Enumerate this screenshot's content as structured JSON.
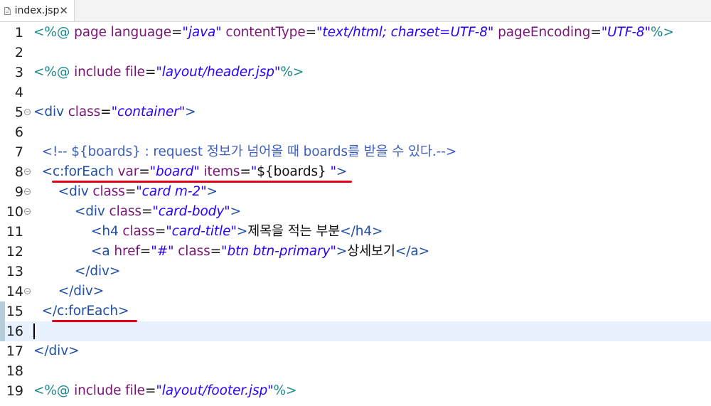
{
  "tab": {
    "title": "index.jsp",
    "icon": "jsp-file-icon",
    "close": "✕"
  },
  "colors": {
    "tag": "#1f4fa6",
    "attr": "#7a1578",
    "string": "#2a00ff",
    "comment": "#3f5fbf",
    "directive": "#1f8a8a",
    "highlight": "#e60012"
  },
  "lines": [
    {
      "num": "1",
      "segs": [
        [
          "tg",
          "<%@ "
        ],
        [
          "an",
          "page "
        ],
        [
          "an",
          "language"
        ],
        [
          "tx",
          "="
        ],
        [
          "sv",
          "\"java\""
        ],
        [
          "tx",
          " "
        ],
        [
          "an",
          "contentType"
        ],
        [
          "tx",
          "="
        ],
        [
          "sv",
          "\"text/html; charset=UTF-8\""
        ],
        [
          "tx",
          " "
        ],
        [
          "an",
          "pageEncoding"
        ],
        [
          "tx",
          "="
        ],
        [
          "sv",
          "\"UTF-8\""
        ],
        [
          "tg",
          "%>"
        ]
      ]
    },
    {
      "num": "2",
      "segs": []
    },
    {
      "num": "3",
      "segs": [
        [
          "tg",
          "<%@ "
        ],
        [
          "an",
          "include "
        ],
        [
          "an",
          "file"
        ],
        [
          "tx",
          "="
        ],
        [
          "sv",
          "\"layout/header.jsp\""
        ],
        [
          "tg",
          "%>"
        ]
      ]
    },
    {
      "num": "4",
      "segs": []
    },
    {
      "num": "5",
      "segs": [
        [
          "tb",
          "<div "
        ],
        [
          "an",
          "class"
        ],
        [
          "tx",
          "="
        ],
        [
          "sv",
          "\"container\""
        ],
        [
          "tb",
          ">"
        ]
      ],
      "fold": true
    },
    {
      "num": "6",
      "segs": []
    },
    {
      "num": "7",
      "segs": [
        [
          "tx",
          "  "
        ],
        [
          "cm",
          "<!-- ${boards} : request 정보가 넘어올 때 boards를 받을 수 있다.-->"
        ]
      ]
    },
    {
      "num": "8",
      "segs": [
        [
          "tx",
          "  "
        ],
        [
          "tb",
          "<c:forEach "
        ],
        [
          "an",
          "var"
        ],
        [
          "tx",
          "="
        ],
        [
          "sv",
          "\"board\""
        ],
        [
          "tx",
          " "
        ],
        [
          "an",
          "items"
        ],
        [
          "tx",
          "="
        ],
        [
          "sv",
          "\""
        ],
        [
          "tx",
          "${boards}"
        ],
        [
          "sv",
          " \""
        ],
        [
          "tb",
          ">"
        ]
      ],
      "fold": true
    },
    {
      "num": "9",
      "segs": [
        [
          "tx",
          "      "
        ],
        [
          "tb",
          "<div "
        ],
        [
          "an",
          "class"
        ],
        [
          "tx",
          "="
        ],
        [
          "sv",
          "\"card m-2\""
        ],
        [
          "tb",
          ">"
        ]
      ],
      "fold": true
    },
    {
      "num": "10",
      "segs": [
        [
          "tx",
          "          "
        ],
        [
          "tb",
          "<div "
        ],
        [
          "an",
          "class"
        ],
        [
          "tx",
          "="
        ],
        [
          "sv",
          "\"card-body\""
        ],
        [
          "tb",
          ">"
        ]
      ],
      "fold": true
    },
    {
      "num": "11",
      "segs": [
        [
          "tx",
          "              "
        ],
        [
          "tb",
          "<h4 "
        ],
        [
          "an",
          "class"
        ],
        [
          "tx",
          "="
        ],
        [
          "sv",
          "\"card-title\""
        ],
        [
          "tb",
          ">"
        ],
        [
          "tx",
          "제목을 적는 부분"
        ],
        [
          "tb",
          "</h4>"
        ]
      ]
    },
    {
      "num": "12",
      "segs": [
        [
          "tx",
          "              "
        ],
        [
          "tb",
          "<a "
        ],
        [
          "an",
          "href"
        ],
        [
          "tx",
          "="
        ],
        [
          "sv",
          "\"#\""
        ],
        [
          "tx",
          " "
        ],
        [
          "an",
          "class"
        ],
        [
          "tx",
          "="
        ],
        [
          "sv",
          "\"btn btn-primary\""
        ],
        [
          "tb",
          ">"
        ],
        [
          "tx",
          "상세보기"
        ],
        [
          "tb",
          "</a>"
        ]
      ]
    },
    {
      "num": "13",
      "segs": [
        [
          "tx",
          "          "
        ],
        [
          "tb",
          "</div>"
        ]
      ]
    },
    {
      "num": "14",
      "segs": [
        [
          "tx",
          "      "
        ],
        [
          "tb",
          "</div>"
        ]
      ],
      "fold": true
    },
    {
      "num": "15",
      "segs": [
        [
          "tx",
          "  "
        ],
        [
          "tb",
          "</c:forEach>"
        ]
      ]
    },
    {
      "num": "16",
      "segs": [],
      "current": true,
      "caret": true
    },
    {
      "num": "17",
      "segs": [
        [
          "tb",
          "</div>"
        ]
      ]
    },
    {
      "num": "18",
      "segs": []
    },
    {
      "num": "19",
      "segs": [
        [
          "tg",
          "<%@ "
        ],
        [
          "an",
          "include "
        ],
        [
          "an",
          "file"
        ],
        [
          "tx",
          "="
        ],
        [
          "sv",
          "\"layout/footer.jsp\""
        ],
        [
          "tg",
          "%>"
        ]
      ]
    }
  ]
}
